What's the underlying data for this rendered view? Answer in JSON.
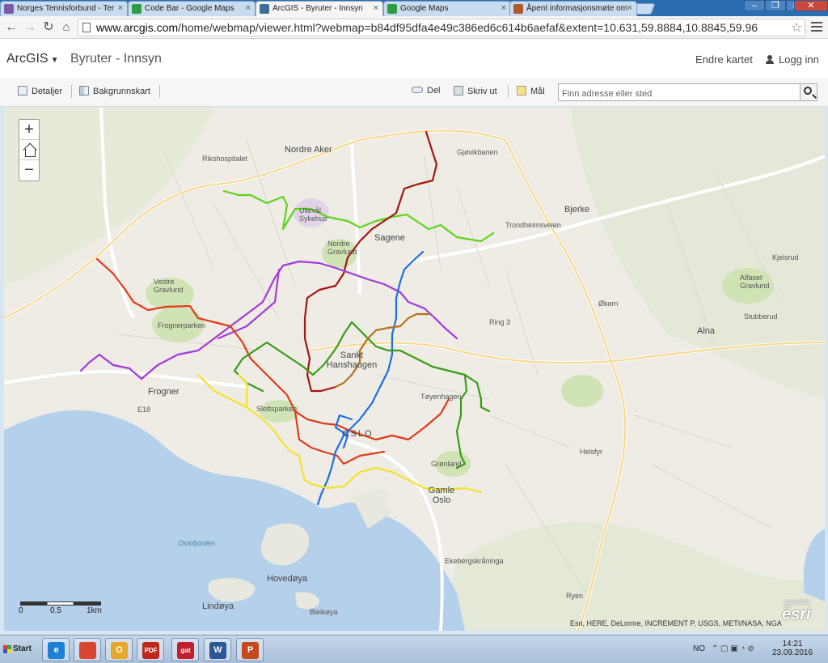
{
  "browser": {
    "tabs": [
      {
        "title": "Norges Tennisforbund - Ter",
        "icon": "tennis-favicon",
        "color": "#7a5ba8"
      },
      {
        "title": "Code Bar - Google Maps",
        "icon": "google-maps-favicon",
        "color": "#2e9e45"
      },
      {
        "title": "ArcGIS - Byruter - Innsyn",
        "icon": "arcgis-favicon",
        "color": "#3d6f9a"
      },
      {
        "title": "Google Maps",
        "icon": "google-maps-favicon",
        "color": "#2e9e45"
      },
      {
        "title": "Åpent informasjonsmøte om",
        "icon": "generic-favicon",
        "color": "#b05a2c"
      }
    ],
    "active_tab_index": 2,
    "url_host": "www.arcgis.com",
    "url_path": "/home/webmap/viewer.html?webmap=b84df95dfa4e49c386ed6c614b6aefaf&extent=10.631,59.8884,10.8845,59.96"
  },
  "header": {
    "brand": "ArcGIS",
    "map_title": "Byruter - Innsyn",
    "edit_map": "Endre kartet",
    "login": "Logg inn"
  },
  "toolbar": {
    "details": "Detaljer",
    "basemap": "Bakgrunnskart",
    "share": "Del",
    "print": "Skriv ut",
    "measure": "Mål",
    "search_placeholder": "Finn adresse eller sted"
  },
  "map": {
    "zoom_in": "+",
    "zoom_out": "−",
    "water_color": "#b5d0ea",
    "land_color": "#f1efe9",
    "park_color": "#cfe3b4",
    "road_color": "#ffffff",
    "route_colors": {
      "green": "#5fd31c",
      "darkred": "#a3160f",
      "purple": "#a33ad9",
      "red": "#e03b1b",
      "blue": "#1f6fe0",
      "darkgreen": "#3a9a1a",
      "yellow": "#f4e132",
      "brown": "#b5721e"
    },
    "labels": [
      "Nordre Aker",
      "Sagene",
      "Sankt Hanshaugen",
      "OSLO",
      "Frogner",
      "Bjerke",
      "Alna",
      "Gamle Oslo",
      "Ullevål Sykehus",
      "Nordre Gravlund",
      "Vestre Gravlund",
      "Frognerparken",
      "Slottsparken",
      "Tøyenhagen",
      "Grønland",
      "Oslofjorden",
      "Hovedøya",
      "Lindøya",
      "Bleikøya",
      "Ring 3",
      "E18",
      "Trondheimsveien",
      "Rikshospitalet",
      "Gjøvikbanen",
      "Økern",
      "Helsfyr",
      "Alfaset Gravlund",
      "Stubberud",
      "Kjelsrud",
      "Ryen",
      "Ekebergskråninga"
    ],
    "scale_labels": [
      "0",
      "0.5",
      "1km"
    ],
    "attribution": "Esri, HERE, DeLorme, INCREMENT P, USGS, METI/NASA, NGA",
    "esri_powered": "POWERED BY",
    "esri_logo": "esri"
  },
  "taskbar": {
    "start": "Start",
    "apps": [
      {
        "name": "ie-icon",
        "color": "#1e7fd6",
        "text": "e"
      },
      {
        "name": "chrome-icon",
        "color": "#d94630",
        "text": ""
      },
      {
        "name": "outlook-icon",
        "color": "#e8a82c",
        "text": "O"
      },
      {
        "name": "pdf-icon",
        "color": "#c0271d",
        "text": "PDF"
      },
      {
        "name": "gat-icon",
        "color": "#c21f2b",
        "text": "gat"
      },
      {
        "name": "word-icon",
        "color": "#2b5797",
        "text": "W"
      },
      {
        "name": "powerpoint-icon",
        "color": "#c44a1d",
        "text": "P"
      }
    ],
    "language": "NO",
    "time": "14:21",
    "date": "23.09.2016"
  }
}
